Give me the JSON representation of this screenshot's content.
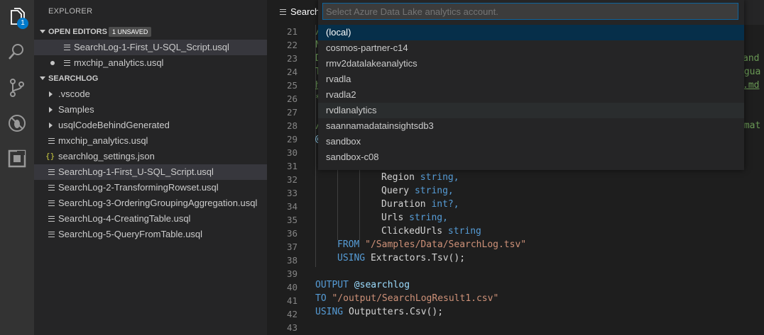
{
  "activity_bar": {
    "icons": [
      "files-icon",
      "search-icon",
      "source-control-icon",
      "debug-icon",
      "extensions-icon"
    ],
    "badge": "1"
  },
  "sidebar": {
    "title": "EXPLORER",
    "open_editors": {
      "header": "OPEN EDITORS",
      "badge": "1 UNSAVED",
      "items": [
        "SearchLog-1-First_U-SQL_Script.usql",
        "mxchip_analytics.usql"
      ]
    },
    "folder": {
      "header": "SEARCHLOG",
      "items": [
        ".vscode",
        "Samples",
        "usqlCodeBehindGenerated",
        "mxchip_analytics.usql",
        "searchlog_settings.json",
        "SearchLog-1-First_U-SQL_Script.usql",
        "SearchLog-2-TransformingRowset.usql",
        "SearchLog-3-OrderingGroupingAggregation.usql",
        "SearchLog-4-CreatingTable.usql",
        "SearchLog-5-QueryFromTable.usql"
      ]
    }
  },
  "tab": {
    "label": "Search"
  },
  "editor": {
    "line_numbers": [
      "21",
      "22",
      "23",
      "24",
      "25",
      "26",
      "27",
      "28",
      "29",
      "30",
      "31",
      "32",
      "33",
      "34",
      "35",
      "36",
      "37",
      "38",
      "39",
      "40",
      "41",
      "42",
      "43"
    ],
    "partial": {
      "l21": "/",
      "l22": "N",
      "l23": "D",
      "l24": "T",
      "l25": "h",
      "l26": "*",
      "l28": "/",
      "l29": "@",
      "r23": "and",
      "r24": "ngua",
      "r25": ".md",
      "r28": "emat"
    },
    "lines": {
      "l32_name": "Region",
      "l32_type": "string,",
      "l33_name": "Query",
      "l33_type": "string,",
      "l34_name": "Duration",
      "l34_type": "int?,",
      "l35_name": "Urls",
      "l35_type": "string,",
      "l36_name": "ClickedUrls",
      "l36_type": "string",
      "l37_kw": "FROM",
      "l37_str": "\"/Samples/Data/SearchLog.tsv\"",
      "l38_kw": "USING",
      "l38_rest": "Extractors.Tsv();",
      "l40_kw": "OUTPUT",
      "l40_var": "@searchlog",
      "l41_kw": "TO",
      "l41_str": "\"/output/SearchLogResult1.csv\"",
      "l42_kw": "USING",
      "l42_rest": "Outputters.Csv();"
    }
  },
  "quick_pick": {
    "placeholder": "Select Azure Data Lake analytics account.",
    "items": [
      "(local)",
      "cosmos-partner-c14",
      "rmv2datalakeanalytics",
      "rvadla",
      "rvadla2",
      "rvdlanalytics",
      "saannamadatainsightsdb3",
      "sandbox",
      "sandbox-c08"
    ]
  },
  "colors": {
    "accent": "#007acc",
    "keyword": "#569cd6",
    "string": "#ce9178",
    "selection": "#062f4a"
  }
}
